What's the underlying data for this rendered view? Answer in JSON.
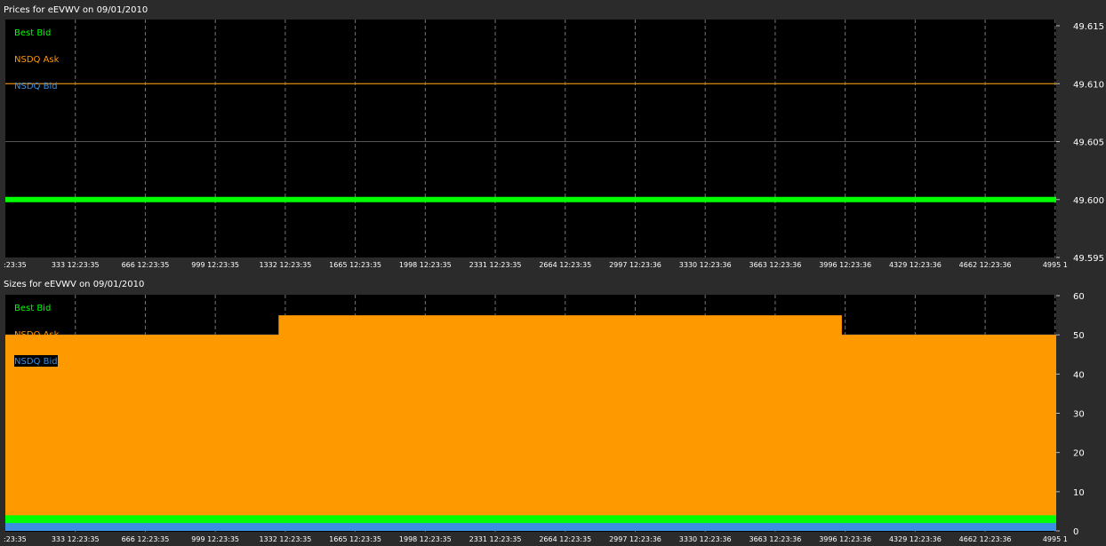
{
  "prices_panel": {
    "title": "Prices for  eEVWV  on  09/01/2010"
  },
  "sizes_panel": {
    "title": "Sizes for  eEVWV  on  09/01/2010"
  },
  "colors": {
    "background": "#000000",
    "frame": "#2b2b2b",
    "best_bid": "#00ff00",
    "nsdq_ask": "#ff9900",
    "nsdq_bid": "#3a8fe0",
    "grid": "#8a8a8a",
    "axis_text": "#ffffff"
  },
  "chart_data": [
    {
      "type": "line",
      "title": "Prices for  eEVWV  on  09/01/2010",
      "categories": [
        ":23:35",
        "333 12:23:35",
        "666 12:23:35",
        "999 12:23:35",
        "1332 12:23:35",
        "1665 12:23:35",
        "1998 12:23:35",
        "2331 12:23:35",
        "2664 12:23:35",
        "2997 12:23:36",
        "3330 12:23:36",
        "3663 12:23:36",
        "3996 12:23:36",
        "4329 12:23:36",
        "4662 12:23:36",
        "4995 1"
      ],
      "y_ticks": [
        "49.615",
        "49.610",
        "49.605",
        "49.600",
        "49.595"
      ],
      "ylim": [
        49.595,
        49.615
      ],
      "xlim": [
        0,
        5000
      ],
      "grid": true,
      "legend": "top-left",
      "series": [
        {
          "name": "Best Bid",
          "color": "#00ff00",
          "x": [
            0,
            5000
          ],
          "values": [
            49.6,
            49.6
          ]
        },
        {
          "name": "NSDQ Ask",
          "color": "#ff9900",
          "x": [
            0,
            5000
          ],
          "values": [
            49.61,
            49.61
          ]
        },
        {
          "name": "NSDQ Bid",
          "color": "#3a8fe0",
          "x": [
            0,
            5000
          ],
          "values": [
            49.6,
            49.6
          ]
        }
      ]
    },
    {
      "type": "area",
      "title": "Sizes for  eEVWV  on  09/01/2010",
      "categories": [
        ":23:35",
        "333 12:23:35",
        "666 12:23:35",
        "999 12:23:35",
        "1332 12:23:35",
        "1665 12:23:35",
        "1998 12:23:35",
        "2331 12:23:35",
        "2664 12:23:35",
        "2997 12:23:36",
        "3330 12:23:36",
        "3663 12:23:36",
        "3996 12:23:36",
        "4329 12:23:36",
        "4662 12:23:36",
        "4995 1"
      ],
      "y_ticks": [
        "60",
        "50",
        "40",
        "30",
        "20",
        "10",
        "0"
      ],
      "ylim": [
        0,
        60
      ],
      "xlim": [
        0,
        5000
      ],
      "grid": true,
      "legend": "top-left",
      "series": [
        {
          "name": "NSDQ Ask",
          "color": "#ff9900",
          "x": [
            0,
            1300,
            1300,
            3980,
            3980,
            5000
          ],
          "values": [
            50,
            50,
            55,
            55,
            50,
            50
          ]
        },
        {
          "name": "Best Bid",
          "color": "#00ff00",
          "x": [
            0,
            5000
          ],
          "values": [
            4,
            4
          ]
        },
        {
          "name": "NSDQ Bid",
          "color": "#3a8fe0",
          "x": [
            0,
            5000
          ],
          "values": [
            2,
            2
          ]
        }
      ]
    }
  ]
}
